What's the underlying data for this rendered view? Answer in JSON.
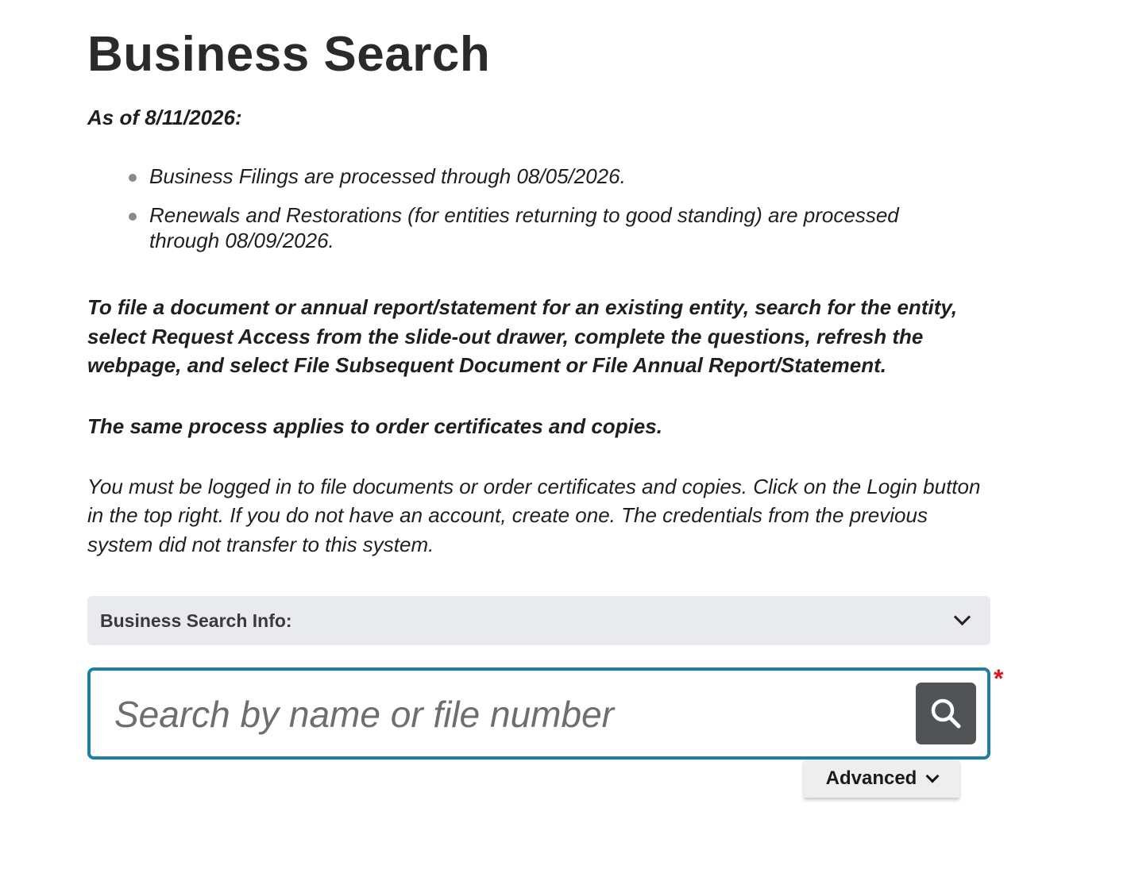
{
  "page": {
    "title": "Business Search",
    "as_of": "As of 8/11/2026:",
    "bullets": [
      "Business Filings are processed through 08/05/2026.",
      "Renewals and Restorations (for entities returning to good standing) are processed through 08/09/2026."
    ],
    "instruction": "To file a document or annual report/statement for an existing entity, search for the entity, select Request Access from the slide-out drawer, complete the questions, refresh the webpage, and select File Subsequent Document or File Annual Report/Statement.",
    "same_process": "The same process applies to order certificates and copies.",
    "login_note": "You must be logged in to file documents or order certificates and copies. Click on the Login button in the top right. If you do not have an account, create one. The credentials from the previous system did not transfer to this system."
  },
  "info_bar": {
    "label": "Business Search Info:",
    "icon": "chevron-down-icon"
  },
  "search": {
    "placeholder": "Search by name or file number",
    "value": "",
    "button_icon": "search-icon",
    "required_marker": "*",
    "border_color": "#1f7ea8",
    "button_color": "#505457"
  },
  "advanced": {
    "label": "Advanced",
    "icon": "chevron-down-icon"
  }
}
